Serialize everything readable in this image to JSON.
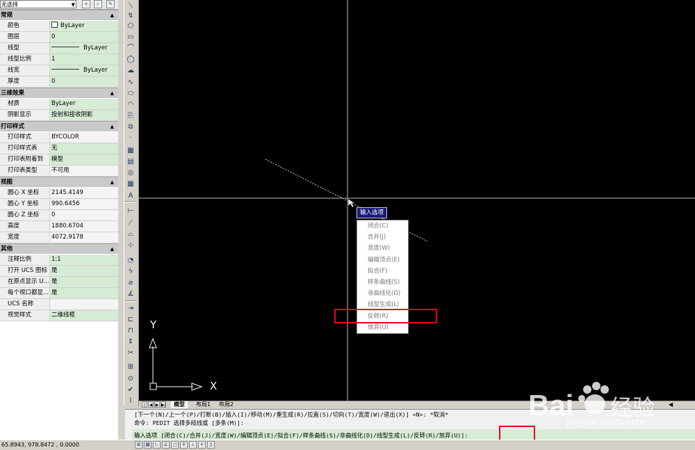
{
  "selection": {
    "combo_value": "无选择"
  },
  "properties": {
    "sections": [
      {
        "title": "常规",
        "rows": [
          {
            "label": "颜色",
            "value": "ByLayer",
            "kind": "color"
          },
          {
            "label": "图层",
            "value": "0"
          },
          {
            "label": "线型",
            "value": "ByLayer",
            "kind": "line"
          },
          {
            "label": "线型比例",
            "value": "1"
          },
          {
            "label": "线宽",
            "value": "ByLayer",
            "kind": "line"
          },
          {
            "label": "厚度",
            "value": "0"
          }
        ]
      },
      {
        "title": "三维效果",
        "rows": [
          {
            "label": "材质",
            "value": "ByLayer"
          },
          {
            "label": "阴影显示",
            "value": "投射和接收阴影"
          }
        ]
      },
      {
        "title": "打印样式",
        "rows": [
          {
            "label": "打印样式",
            "value": "BYCOLOR",
            "ro": true
          },
          {
            "label": "打印样式表",
            "value": "无"
          },
          {
            "label": "打印表附着到",
            "value": "模型"
          },
          {
            "label": "打印表类型",
            "value": "不可用",
            "ro": true
          }
        ]
      },
      {
        "title": "视图",
        "rows": [
          {
            "label": "圆心 X 坐标",
            "value": "2145.4149",
            "ro": true
          },
          {
            "label": "圆心 Y 坐标",
            "value": "990.6456",
            "ro": true
          },
          {
            "label": "圆心 Z 坐标",
            "value": "0",
            "ro": true
          },
          {
            "label": "高度",
            "value": "1880.6704",
            "ro": true
          },
          {
            "label": "宽度",
            "value": "4072.9178",
            "ro": true
          }
        ]
      },
      {
        "title": "其他",
        "rows": [
          {
            "label": "注释比例",
            "value": "1:1"
          },
          {
            "label": "打开 UCS 图标",
            "value": "是"
          },
          {
            "label": "在原点显示 U...",
            "value": "是"
          },
          {
            "label": "每个视口都显...",
            "value": "是"
          },
          {
            "label": "UCS 名称",
            "value": "",
            "ro": true
          },
          {
            "label": "视觉样式",
            "value": "二维线框"
          }
        ]
      }
    ]
  },
  "canvas": {
    "context_title": "输入选项",
    "menu_items": [
      "闭合(C)",
      "合并(J)",
      "宽度(W)",
      "编辑顶点(E)",
      "拟合(F)",
      "样条曲线(S)",
      "非曲线化(D)",
      "线型生成(L)",
      "反转(R)",
      "放弃(U)"
    ],
    "highlighted_item": "反转(R)",
    "ucs_x": "X",
    "ucs_y": "Y"
  },
  "tabs": {
    "items": [
      "模型",
      "布局1",
      "布局2"
    ],
    "active": "模型"
  },
  "command": {
    "line1": "[下一个(N)/上一个(P)/打断(B)/插入(I)/移动(M)/重生成(R)/拉直(S)/切向(T)/宽度(W)/退出(X)] <N>: *取消*",
    "line2": "命令:  PEDIT 选择多段线或 [多条(M)]:",
    "line3": "输入选项 [闭合(C)/合并(J)/宽度(W)/编辑顶点(E)/拟合(F)/样条曲线(S)/非曲线化(D)/线型生成(L)/反转(R)/放弃(U)]:"
  },
  "status": {
    "coords": "65.8943,  978.8472 ,  0.0000"
  },
  "watermark": {
    "brand": "Bai经验",
    "url": "jingyan.baidu.com"
  },
  "colors": {
    "canvas_bg": "#000000",
    "green_cell": "#d6ecd5",
    "highlight_red": "#e8001c",
    "menu_title_bg": "#1a1a7a"
  }
}
